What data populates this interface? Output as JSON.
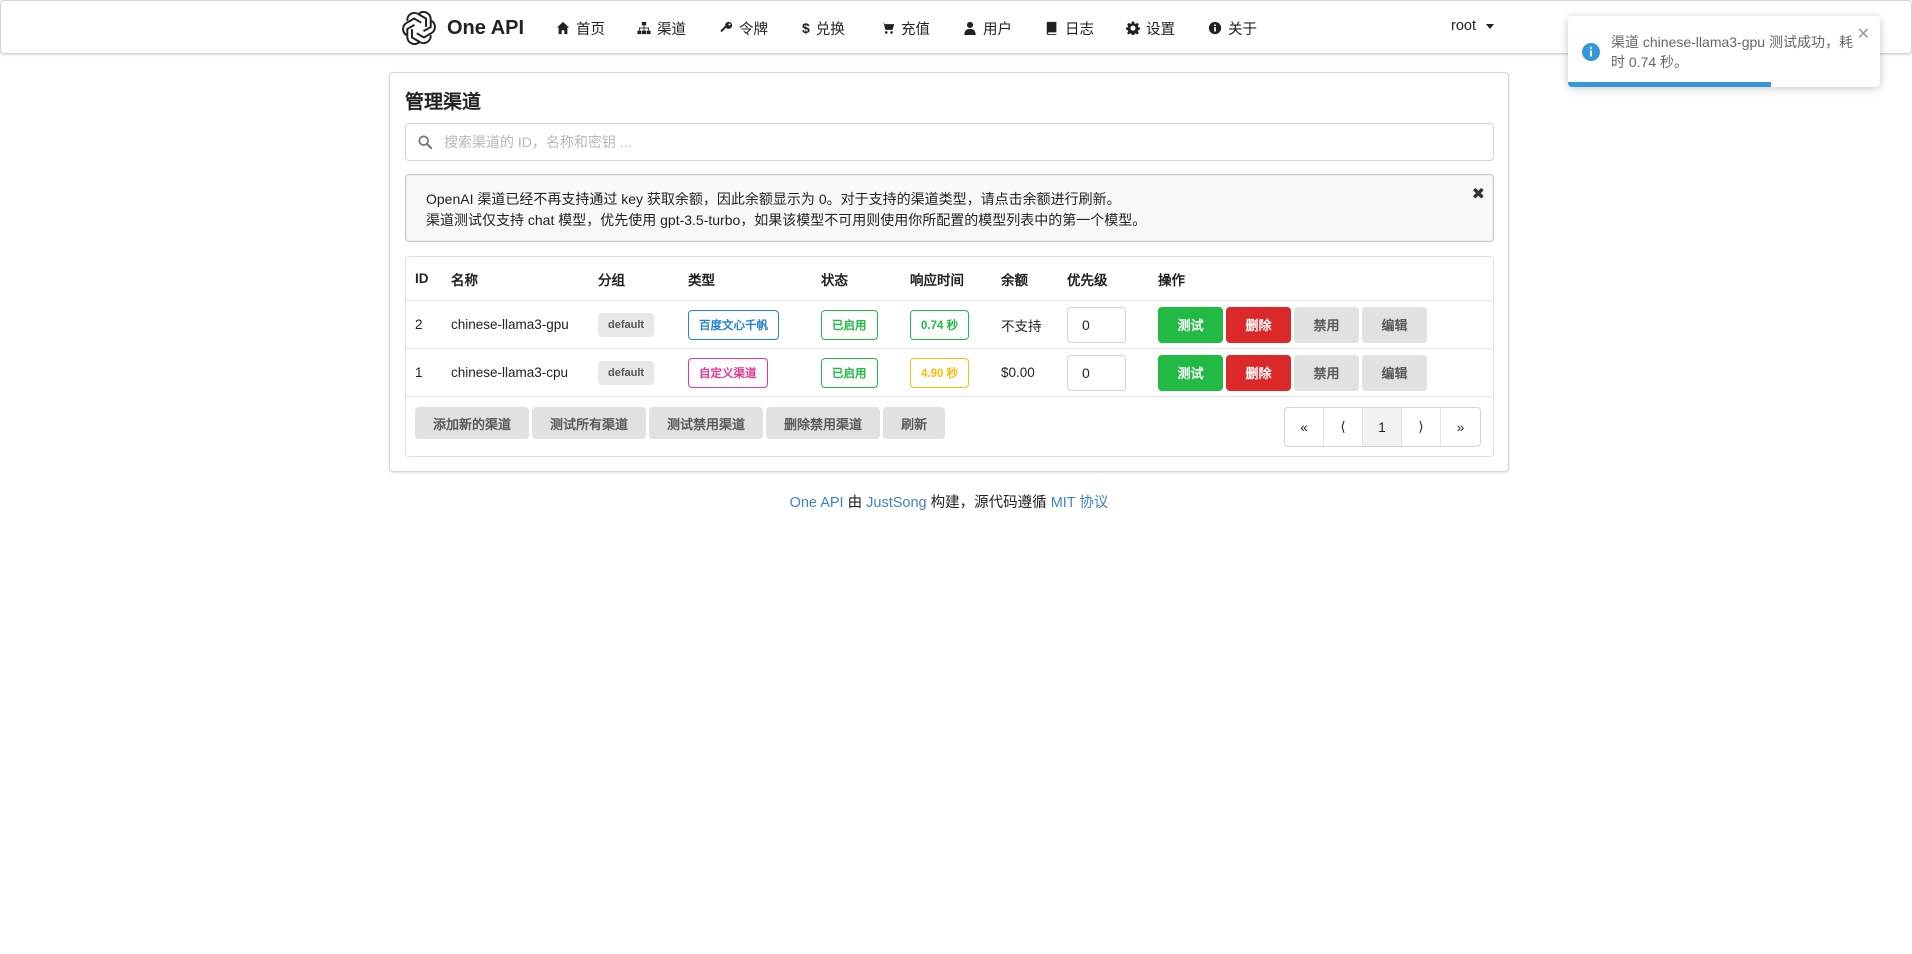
{
  "brand": {
    "name": "One API",
    "logo": "openai-logo-icon"
  },
  "nav": {
    "items": [
      {
        "label": "首页",
        "icon": "home-icon"
      },
      {
        "label": "渠道",
        "icon": "sitemap-icon"
      },
      {
        "label": "令牌",
        "icon": "key-icon"
      },
      {
        "label": "兑换",
        "icon": "dollar-icon"
      },
      {
        "label": "充值",
        "icon": "cart-icon"
      },
      {
        "label": "用户",
        "icon": "user-icon"
      },
      {
        "label": "日志",
        "icon": "book-icon"
      },
      {
        "label": "设置",
        "icon": "gear-icon"
      },
      {
        "label": "关于",
        "icon": "info-circle-icon"
      }
    ],
    "user": "root"
  },
  "page": {
    "title": "管理渠道",
    "search_placeholder": "搜索渠道的 ID，名称和密钥 ...",
    "notice_line1": "OpenAI 渠道已经不再支持通过 key 获取余额，因此余额显示为 0。对于支持的渠道类型，请点击余额进行刷新。",
    "notice_line2": "渠道测试仅支持 chat 模型，优先使用 gpt-3.5-turbo，如果该模型不可用则使用你所配置的模型列表中的第一个模型。",
    "notice_close": "✖"
  },
  "table": {
    "headers": {
      "id": "ID",
      "name": "名称",
      "group": "分组",
      "type": "类型",
      "status": "状态",
      "response_time": "响应时间",
      "balance": "余额",
      "priority": "优先级",
      "actions": "操作"
    },
    "rows": [
      {
        "id": "2",
        "name": "chinese-llama3-gpu",
        "group": "default",
        "type": "百度文心千帆",
        "status": "已启用",
        "response_time": "0.74 秒",
        "balance": "不支持",
        "priority": "0"
      },
      {
        "id": "1",
        "name": "chinese-llama3-cpu",
        "group": "default",
        "type": "自定义渠道",
        "status": "已启用",
        "response_time": "4.90 秒",
        "balance": "$0.00",
        "priority": "0"
      }
    ],
    "actions": {
      "test": "测试",
      "delete": "删除",
      "disable": "禁用",
      "edit": "编辑"
    }
  },
  "bottom_buttons": {
    "add": "添加新的渠道",
    "test_all": "测试所有渠道",
    "test_disabled": "测试禁用渠道",
    "delete_disabled": "删除禁用渠道",
    "refresh": "刷新"
  },
  "pagination": {
    "first": "«",
    "prev": "⟨",
    "current": "1",
    "next": "⟩",
    "last": "»"
  },
  "footer": {
    "link1": "One API",
    "text1": " 由 ",
    "link2": "JustSong",
    "text2": " 构建，源代码遵循 ",
    "link3": "MIT 协议"
  },
  "toast": {
    "message": "渠道 chinese-llama3-gpu 测试成功，耗时 0.74 秒。",
    "close": "✕",
    "progress": 0.65
  },
  "colors": {
    "green": "#21ba45",
    "red": "#db2828",
    "blue": "#2185d0",
    "pink": "#e03997",
    "olive_yellow": "#fbbd08",
    "link": "#4183c4",
    "toast_progress": "#3498db"
  }
}
